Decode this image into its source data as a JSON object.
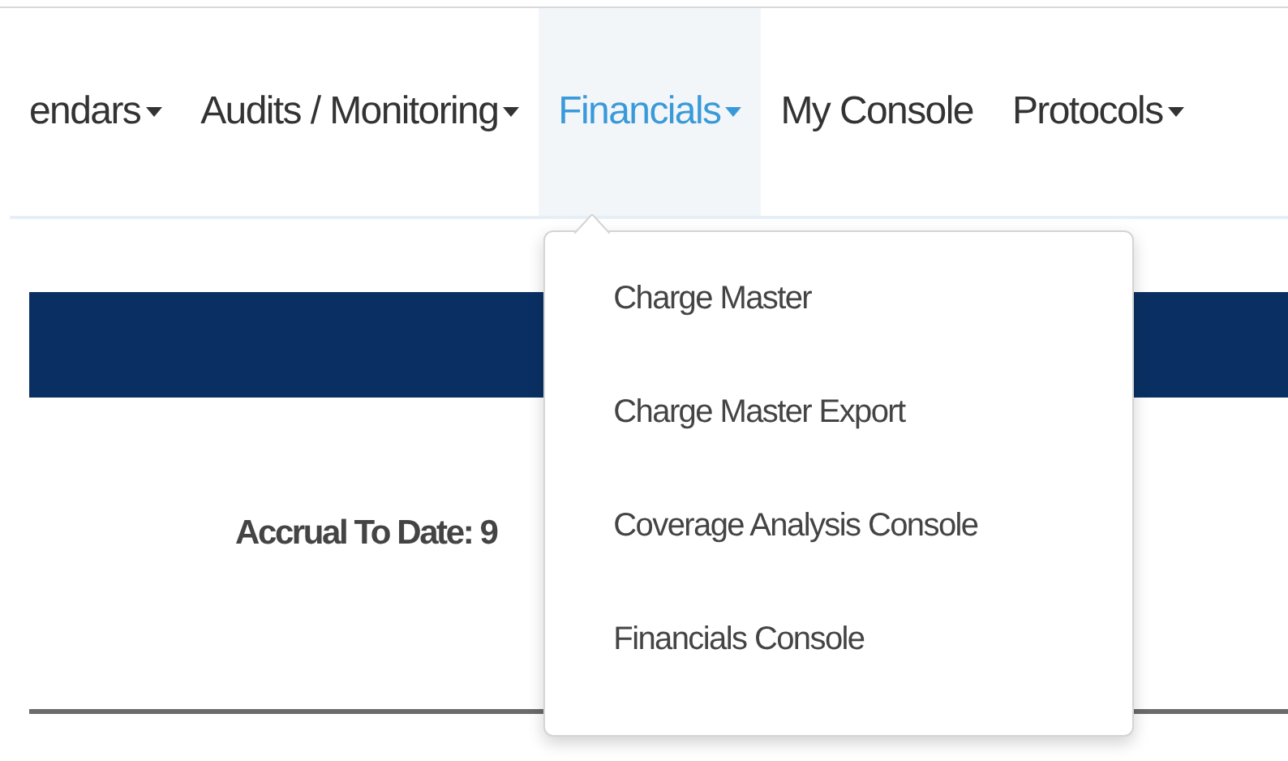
{
  "nav": {
    "items": [
      {
        "label": "endars",
        "kind": "dropdown",
        "selected": false
      },
      {
        "label": "Audits / Monitoring",
        "kind": "dropdown",
        "selected": false
      },
      {
        "label": "Financials",
        "kind": "dropdown",
        "selected": true
      },
      {
        "label": "My Console",
        "kind": "link",
        "selected": false
      },
      {
        "label": "Protocols",
        "kind": "dropdown",
        "selected": false
      }
    ]
  },
  "menu": {
    "items": [
      "Charge Master",
      "Charge Master Export",
      "Coverage Analysis Console",
      "Financials Console"
    ]
  },
  "summary": {
    "text": "Accrual To Date: 9"
  }
}
